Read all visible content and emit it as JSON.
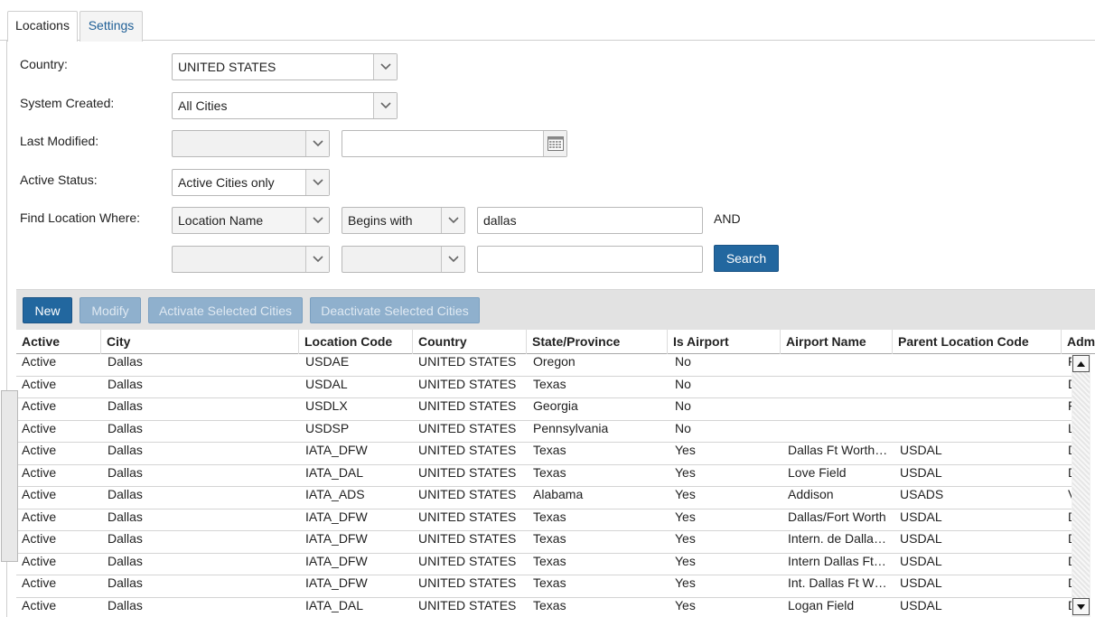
{
  "tabs": [
    {
      "label": "Locations",
      "active": true
    },
    {
      "label": "Settings",
      "active": false
    }
  ],
  "form": {
    "country": {
      "label": "Country:",
      "value": "UNITED STATES"
    },
    "system_created": {
      "label": "System Created:",
      "value": "All Cities"
    },
    "last_modified": {
      "label": "Last Modified:",
      "value": "",
      "date_value": ""
    },
    "active_status": {
      "label": "Active Status:",
      "value": "Active Cities only"
    },
    "find_location": {
      "label": "Find Location Where:",
      "field": "Location Name",
      "operator": "Begins with",
      "value": "dallas",
      "conjunction": "AND",
      "field2": "",
      "operator2": "",
      "value2": ""
    },
    "search_label": "Search"
  },
  "toolbar": {
    "new_label": "New",
    "modify_label": "Modify",
    "activate_label": "Activate Selected Cities",
    "deactivate_label": "Deactivate Selected Cities"
  },
  "grid": {
    "columns": [
      "Active",
      "City",
      "Location Code",
      "Country",
      "State/Province",
      "Is Airport",
      "Airport Name",
      "Parent Location Code",
      "Adm"
    ],
    "rows": [
      {
        "active": "Active",
        "city": "Dallas",
        "code": "USDAE",
        "country": "UNITED STATES",
        "state": "Oregon",
        "airport": "No",
        "airport_name": "",
        "parent": "",
        "adm": "F"
      },
      {
        "active": "Active",
        "city": "Dallas",
        "code": "USDAL",
        "country": "UNITED STATES",
        "state": "Texas",
        "airport": "No",
        "airport_name": "",
        "parent": "",
        "adm": "D"
      },
      {
        "active": "Active",
        "city": "Dallas",
        "code": "USDLX",
        "country": "UNITED STATES",
        "state": "Georgia",
        "airport": "No",
        "airport_name": "",
        "parent": "",
        "adm": "F"
      },
      {
        "active": "Active",
        "city": "Dallas",
        "code": "USDSP",
        "country": "UNITED STATES",
        "state": "Pennsylvania",
        "airport": "No",
        "airport_name": "",
        "parent": "",
        "adm": "L"
      },
      {
        "active": "Active",
        "city": "Dallas",
        "code": "IATA_DFW",
        "country": "UNITED STATES",
        "state": "Texas",
        "airport": "Yes",
        "airport_name": "Dallas Ft Worth…",
        "parent": "USDAL",
        "adm": "D"
      },
      {
        "active": "Active",
        "city": "Dallas",
        "code": "IATA_DAL",
        "country": "UNITED STATES",
        "state": "Texas",
        "airport": "Yes",
        "airport_name": "Love Field",
        "parent": "USDAL",
        "adm": "D"
      },
      {
        "active": "Active",
        "city": "Dallas",
        "code": "IATA_ADS",
        "country": "UNITED STATES",
        "state": "Alabama",
        "airport": "Yes",
        "airport_name": "Addison",
        "parent": "USADS",
        "adm": "V"
      },
      {
        "active": "Active",
        "city": "Dallas",
        "code": "IATA_DFW",
        "country": "UNITED STATES",
        "state": "Texas",
        "airport": "Yes",
        "airport_name": "Dallas/Fort Worth",
        "parent": "USDAL",
        "adm": "D"
      },
      {
        "active": "Active",
        "city": "Dallas",
        "code": "IATA_DFW",
        "country": "UNITED STATES",
        "state": "Texas",
        "airport": "Yes",
        "airport_name": "Intern. de Dalla…",
        "parent": "USDAL",
        "adm": "D"
      },
      {
        "active": "Active",
        "city": "Dallas",
        "code": "IATA_DFW",
        "country": "UNITED STATES",
        "state": "Texas",
        "airport": "Yes",
        "airport_name": "Intern Dallas Ft…",
        "parent": "USDAL",
        "adm": "D"
      },
      {
        "active": "Active",
        "city": "Dallas",
        "code": "IATA_DFW",
        "country": "UNITED STATES",
        "state": "Texas",
        "airport": "Yes",
        "airport_name": "Int. Dallas Ft W…",
        "parent": "USDAL",
        "adm": "D"
      },
      {
        "active": "Active",
        "city": "Dallas",
        "code": "IATA_DAL",
        "country": "UNITED STATES",
        "state": "Texas",
        "airport": "Yes",
        "airport_name": "Logan Field",
        "parent": "USDAL",
        "adm": "D"
      }
    ]
  },
  "icons": {
    "dropdown": "chevron-down-icon",
    "calendar": "calendar-icon",
    "scroll_up": "arrow-up-icon",
    "scroll_down": "arrow-down-icon"
  },
  "colors": {
    "primary_button": "#22679f",
    "tab_link": "#1f5f96",
    "toolbar_bg": "#e2e2e2"
  }
}
